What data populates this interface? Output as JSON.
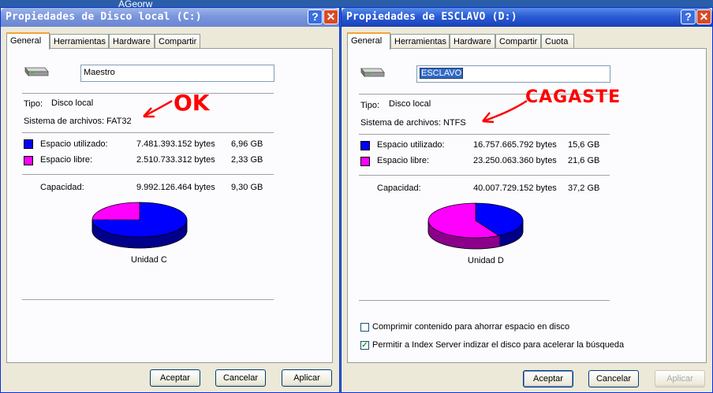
{
  "desktop": {
    "label": "AGeorw"
  },
  "left": {
    "title": "Propiedades de Disco local (C:)",
    "tabs": [
      "General",
      "Herramientas",
      "Hardware",
      "Compartir"
    ],
    "name_value": "Maestro",
    "type_label": "Tipo:",
    "type_value": "Disco local",
    "fs_label": "Sistema de archivos:",
    "fs_value": "FAT32",
    "used_label": "Espacio utilizado:",
    "used_bytes": "7.481.393.152 bytes",
    "used_gb": "6,96 GB",
    "free_label": "Espacio libre:",
    "free_bytes": "2.510.733.312 bytes",
    "free_gb": "2,33 GB",
    "cap_label": "Capacidad:",
    "cap_bytes": "9.992.126.464 bytes",
    "cap_gb": "9,30 GB",
    "unit_label": "Unidad C",
    "annotation": "OK",
    "used_fraction": 0.749,
    "buttons": {
      "ok": "Aceptar",
      "cancel": "Cancelar",
      "apply": "Aplicar"
    }
  },
  "right": {
    "title": "Propiedades de ESCLAVO (D:)",
    "tabs": [
      "General",
      "Herramientas",
      "Hardware",
      "Compartir",
      "Cuota"
    ],
    "name_value": "ESCLAVO",
    "type_label": "Tipo:",
    "type_value": "Disco local",
    "fs_label": "Sistema de archivos:",
    "fs_value": "NTFS",
    "used_label": "Espacio utilizado:",
    "used_bytes": "16.757.665.792 bytes",
    "used_gb": "15,6 GB",
    "free_label": "Espacio libre:",
    "free_bytes": "23.250.063.360 bytes",
    "free_gb": "21,6 GB",
    "cap_label": "Capacidad:",
    "cap_bytes": "40.007.729.152 bytes",
    "cap_gb": "37,2 GB",
    "unit_label": "Unidad D",
    "annotation": "CAGASTE",
    "used_fraction": 0.419,
    "compress_label": "Comprimir contenido para ahorrar espacio en disco",
    "compress_checked": false,
    "index_label": "Permitir a Index Server indizar el disco para acelerar la búsqueda",
    "index_checked": true,
    "buttons": {
      "ok": "Aceptar",
      "cancel": "Cancelar",
      "apply": "Aplicar"
    }
  },
  "colors": {
    "used": "#0000ff",
    "free": "#ff00ff",
    "used_dark": "#00008b",
    "free_dark": "#8b008b",
    "annotation": "#ff0000",
    "title_active": "#2a5cd6"
  }
}
